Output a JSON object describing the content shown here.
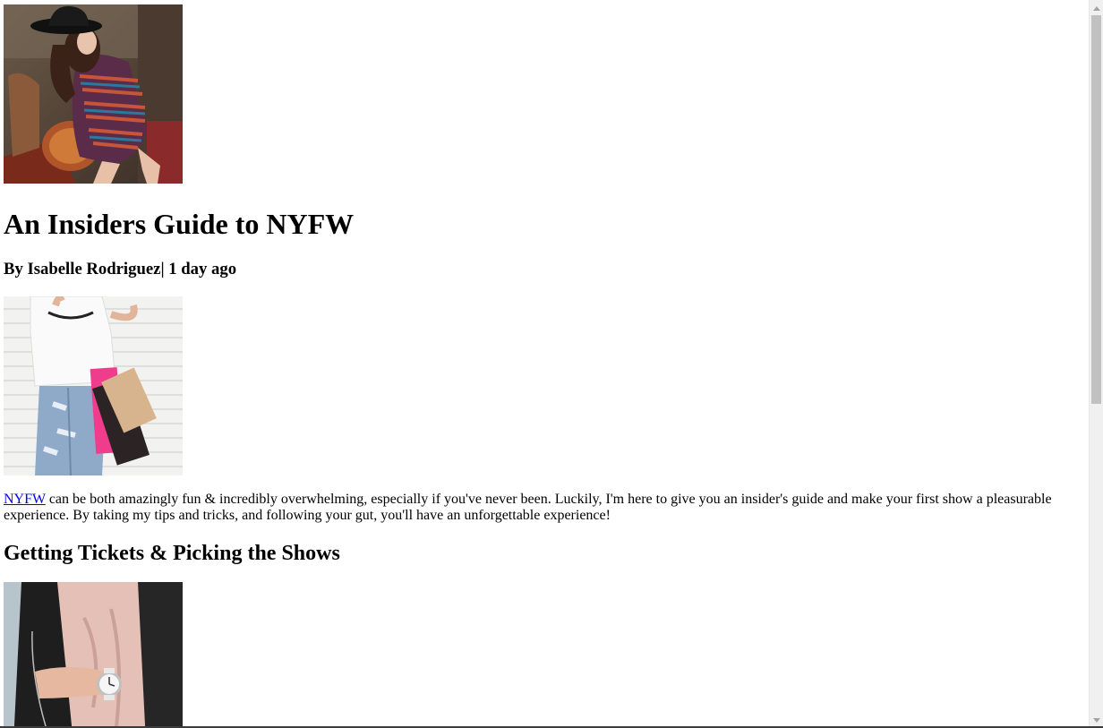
{
  "article": {
    "title": "An Insiders Guide to NYFW",
    "byline": "By Isabelle Rodriguez| 1 day ago",
    "intro_link": "NYFW",
    "intro_text": " can be both amazingly fun & incredibly overwhelming, especially if you've never been. Luckily, I'm here to give you an insider's guide and make your first show a pleasurable experience. By taking my tips and tricks, and following your gut, you'll have an unforgettable experience!",
    "section_heading": "Getting Tickets & Picking the Shows"
  },
  "images": {
    "hero": "woman-in-hat-and-striped-dress-photo",
    "shopping": "woman-with-shopping-bags-photo",
    "watch": "wrist-watch-leather-jacket-photo"
  },
  "scrollbar": {
    "up_icon": "triangle-up-icon",
    "down_icon": "triangle-down-icon"
  }
}
